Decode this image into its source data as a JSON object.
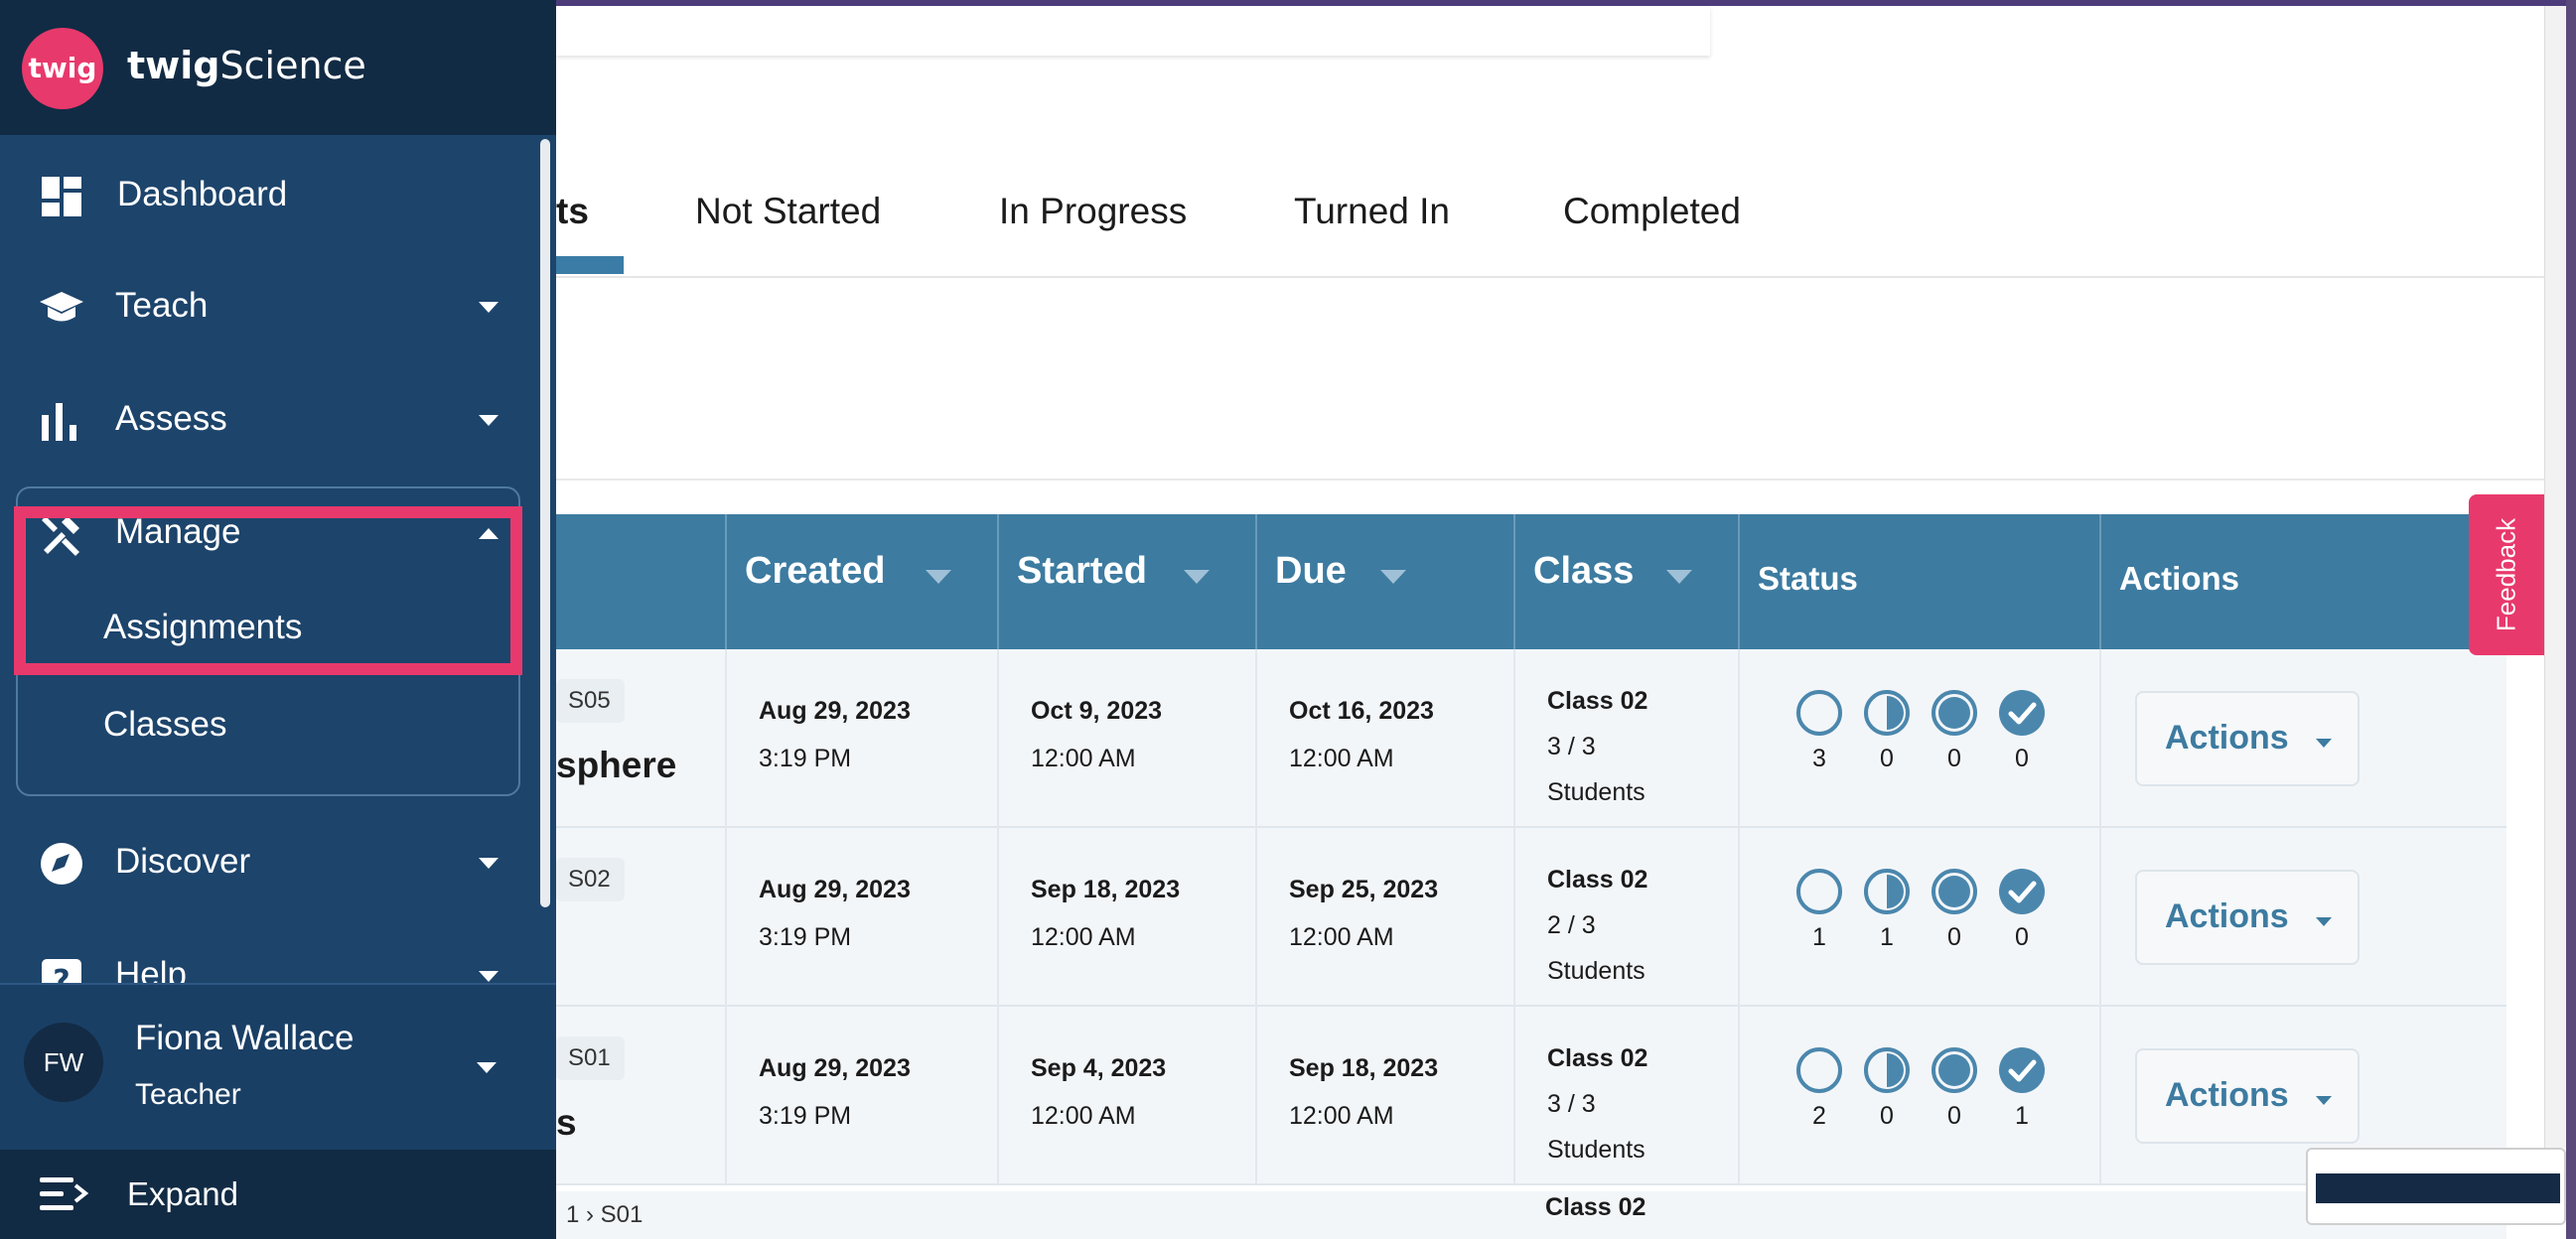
{
  "brand": {
    "logo_text": "twig",
    "name_part1": "twig",
    "name_part2": "Science"
  },
  "sidebar": {
    "items": [
      {
        "label": "Dashboard",
        "icon": "dashboard-icon"
      },
      {
        "label": "Teach",
        "icon": "graduation-cap-icon"
      },
      {
        "label": "Assess",
        "icon": "bar-chart-icon"
      },
      {
        "label": "Manage",
        "icon": "tools-icon"
      },
      {
        "label": "Discover",
        "icon": "compass-icon"
      },
      {
        "label": "Help",
        "icon": "help-icon"
      }
    ],
    "manage_sub": [
      "Assignments",
      "Classes"
    ],
    "user": {
      "initials": "FW",
      "name": "Fiona Wallace",
      "role": "Teacher"
    },
    "expand_label": "Expand"
  },
  "tabs": [
    "ts",
    "Not Started",
    "In Progress",
    "Turned In",
    "Completed"
  ],
  "table": {
    "headers": {
      "created": "Created",
      "started": "Started",
      "due": "Due",
      "class": "Class",
      "status": "Status",
      "actions": "Actions"
    },
    "rows": [
      {
        "code": "S05",
        "title_fragment": "sphere",
        "created_date": "Aug 29, 2023",
        "created_time": "3:19 PM",
        "started_date": "Oct 9, 2023",
        "started_time": "12:00 AM",
        "due_date": "Oct 16, 2023",
        "due_time": "12:00 AM",
        "class_name": "Class 02",
        "class_count": "3 / 3",
        "class_students": "Students",
        "status_counts": [
          "3",
          "0",
          "0",
          "0"
        ],
        "action_label": "Actions"
      },
      {
        "code": "S02",
        "title_fragment": "",
        "created_date": "Aug 29, 2023",
        "created_time": "3:19 PM",
        "started_date": "Sep 18, 2023",
        "started_time": "12:00 AM",
        "due_date": "Sep 25, 2023",
        "due_time": "12:00 AM",
        "class_name": "Class 02",
        "class_count": "2 / 3",
        "class_students": "Students",
        "status_counts": [
          "1",
          "1",
          "0",
          "0"
        ],
        "action_label": "Actions"
      },
      {
        "code": "S01",
        "title_fragment": "s",
        "created_date": "Aug 29, 2023",
        "created_time": "3:19 PM",
        "started_date": "Sep 4, 2023",
        "started_time": "12:00 AM",
        "due_date": "Sep 18, 2023",
        "due_time": "12:00 AM",
        "class_name": "Class 02",
        "class_count": "3 / 3",
        "class_students": "Students",
        "status_counts": [
          "2",
          "0",
          "0",
          "1"
        ],
        "action_label": "Actions"
      }
    ],
    "partial_row": {
      "breadcrumb": "1 › S01",
      "class_name": "Class 02"
    }
  },
  "feedback_label": "Feedback",
  "colors": {
    "sidebar": "#1d446b",
    "sidebar_dark": "#122b44",
    "accent": "#e8396c",
    "table_header": "#3d7ba0"
  }
}
